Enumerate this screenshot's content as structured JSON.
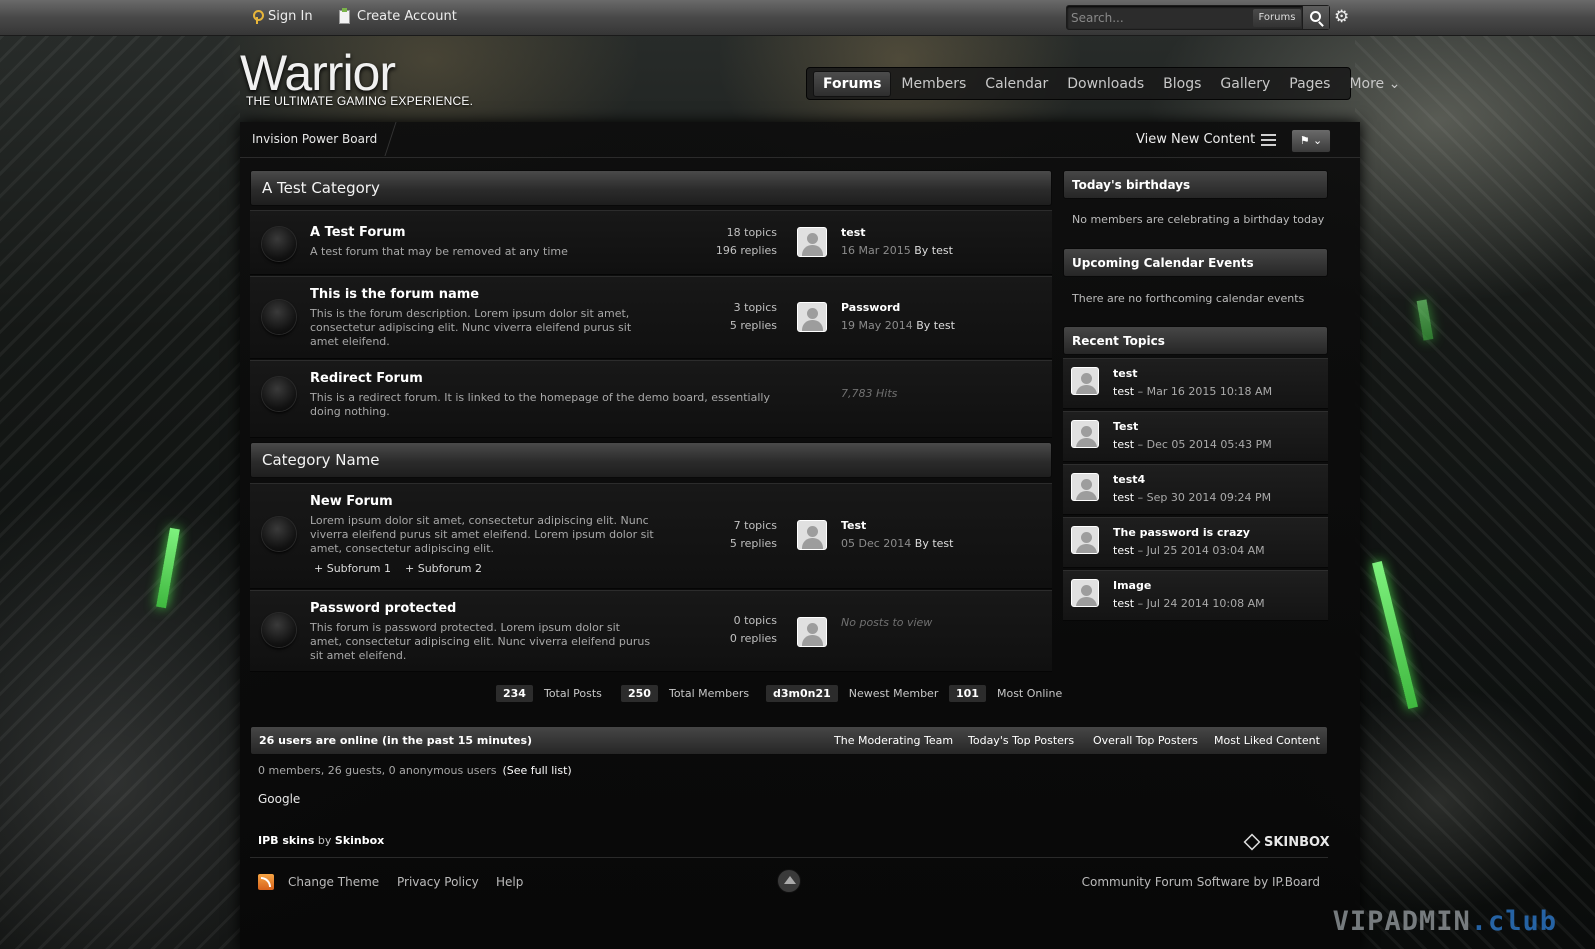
{
  "topbar": {
    "sign_in": "Sign In",
    "create_account": "Create Account",
    "search_placeholder": "Search...",
    "search_scope": "Forums"
  },
  "brand": {
    "logo": "Warrior",
    "tagline": "THE ULTIMATE GAMING EXPERIENCE."
  },
  "nav": [
    "Forums",
    "Members",
    "Calendar",
    "Downloads",
    "Blogs",
    "Gallery",
    "Pages",
    "More ⌄"
  ],
  "breadcrumb": "Invision Power Board",
  "toolbar": {
    "view_new_content": "View New Content",
    "lang": "⚑ ⌄"
  },
  "categories": [
    {
      "title": "A Test Category",
      "forums": [
        {
          "name": "A Test Forum",
          "desc": "A test forum that may be removed at any time",
          "topics": "18 topics",
          "replies": "196 replies",
          "last_title": "test",
          "last_date": "16 Mar 2015",
          "last_by": "By test"
        },
        {
          "name": "This is the forum name",
          "desc": "This is the forum description. Lorem ipsum dolor sit amet, consectetur adipiscing elit. Nunc viverra eleifend purus sit amet eleifend.",
          "topics": "3 topics",
          "replies": "5 replies",
          "last_title": "Password",
          "last_date": "19 May 2014",
          "last_by": "By test"
        },
        {
          "name": "Redirect Forum",
          "desc": "This is a redirect forum. It is linked to the homepage of the demo board, essentially doing nothing.",
          "hits": "7,783 Hits"
        }
      ]
    },
    {
      "title": "Category Name",
      "forums": [
        {
          "name": "New Forum",
          "desc": "Lorem ipsum dolor sit amet, consectetur adipiscing elit. Nunc viverra eleifend purus sit amet eleifend. Lorem ipsum dolor sit amet, consectetur adipiscing elit.",
          "topics": "7 topics",
          "replies": "5 replies",
          "last_title": "Test",
          "last_date": "05 Dec 2014",
          "last_by": "By test",
          "subforums": [
            "Subforum 1",
            "Subforum 2"
          ]
        },
        {
          "name": "Password protected",
          "desc": "This forum is password protected. Lorem ipsum dolor sit amet, consectetur adipiscing elit. Nunc viverra eleifend purus sit amet eleifend.",
          "topics": "0 topics",
          "replies": "0 replies",
          "no_posts": "No posts to view"
        }
      ]
    }
  ],
  "stats": [
    {
      "value": "234",
      "label": "Total Posts"
    },
    {
      "value": "250",
      "label": "Total Members"
    },
    {
      "value": "d3m0n21",
      "label": "Newest Member"
    },
    {
      "value": "101",
      "label": "Most Online"
    }
  ],
  "online": {
    "title": "26 users are online (in the past 15 minutes)",
    "links": [
      "The Moderating Team",
      "Today's Top Posters",
      "Overall Top Posters",
      "Most Liked Content"
    ],
    "detail": "0 members, 26 guests, 0 anonymous users",
    "full_list": "(See full list)",
    "bot": "Google"
  },
  "credit": {
    "a": "IPB skins",
    "by": " by ",
    "b": "Skinbox",
    "logo": "SKINBOX"
  },
  "footer": {
    "links": [
      "Change Theme",
      "Privacy Policy",
      "Help"
    ],
    "right": "Community Forum Software by IP.Board"
  },
  "sidebar": {
    "birthdays_title": "Today's birthdays",
    "birthdays_text": "No members are celebrating a birthday today",
    "events_title": "Upcoming Calendar Events",
    "events_text": "There are no forthcoming calendar events",
    "recent_title": "Recent Topics",
    "recent": [
      {
        "title": "test",
        "by": "test",
        "date": " – Mar 16 2015 10:18 AM"
      },
      {
        "title": "Test",
        "by": "test",
        "date": " – Dec 05 2014 05:43 PM"
      },
      {
        "title": "test4",
        "by": "test",
        "date": " – Sep 30 2014 09:24 PM"
      },
      {
        "title": "The password is crazy",
        "by": "test",
        "date": " – Jul 25 2014 03:04 AM"
      },
      {
        "title": "Image",
        "by": "test",
        "date": " – Jul 24 2014 10:08 AM"
      }
    ]
  },
  "watermark": {
    "a": "VIPADMIN",
    "b": ".club"
  }
}
